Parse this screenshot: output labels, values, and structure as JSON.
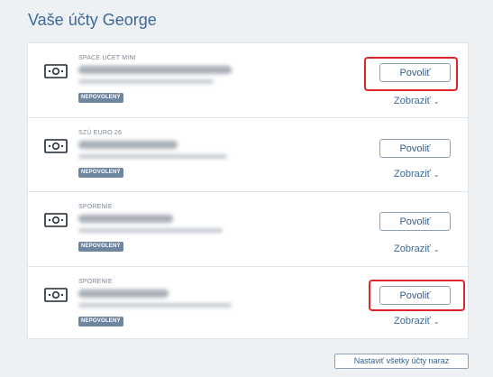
{
  "page_title": "Vaše účty George",
  "accounts": [
    {
      "type": "SPACE ÚČET MINI",
      "badge": "NEPOVOLENÝ",
      "allow_label": "Povoliť",
      "show_label": "Zobraziť",
      "highlighted": true
    },
    {
      "type": "SZÚ EURO 26",
      "badge": "NEPOVOLENÝ",
      "allow_label": "Povoliť",
      "show_label": "Zobraziť",
      "highlighted": false
    },
    {
      "type": "SPORENIE",
      "badge": "NEPOVOLENÝ",
      "allow_label": "Povoliť",
      "show_label": "Zobraziť",
      "highlighted": false
    },
    {
      "type": "SPORENIE",
      "badge": "NEPOVOLENÝ",
      "allow_label": "Povoliť",
      "show_label": "Zobraziť",
      "highlighted": true
    }
  ],
  "footer": {
    "set_all_label": "Nastaviť všetky účty naraz"
  },
  "colors": {
    "title": "#3a6a99",
    "badge_bg": "#6e86a0",
    "highlight": "#e0262b",
    "background": "#eef1f4"
  },
  "icons": {
    "account": "banknote-icon",
    "show": "chevron-down-icon"
  }
}
